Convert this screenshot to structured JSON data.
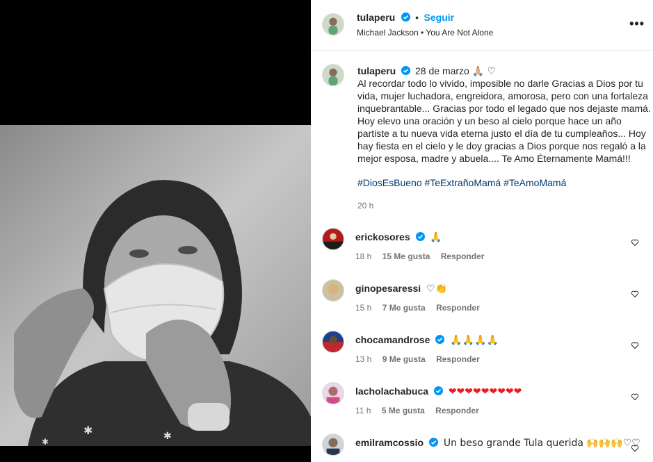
{
  "post": {
    "media_alt_icon": "person-with-face-mask-photo"
  },
  "header": {
    "username": "tulaperu",
    "separator": "•",
    "follow_label": "Seguir",
    "audio": "Michael Jackson • You Are Not Alone",
    "more_icon": "more-dots-icon"
  },
  "caption": {
    "username": "tulaperu",
    "date": "28 de marzo",
    "date_emojis": "🙏🏼 ♡",
    "lines": [
      "Al recordar todo lo vivido, imposible no darle Gracias a Dios por tu",
      "vida, mujer luchadora, engreidora, amorosa, pero con una fortaleza",
      "inquebrantable... Gracias por todo el legado que nos dejaste mamá.",
      "Hoy elevo una oración y un beso al cielo porque hace un año",
      "partiste a tu nueva vida eterna justo el día de tu cumpleaños... Hoy",
      "hay fiesta en el cielo y le doy gracias a Dios porque nos regaló a la",
      "mejor esposa, madre y abuela.... Te Amo Éternamente Mamá!!!"
    ],
    "hashtags": "#DiosEsBueno #TeExtrañoMamá #TeAmoMamá",
    "time": "20 h"
  },
  "comments": [
    {
      "username": "erickosores",
      "text": "🙏",
      "time": "18 h",
      "likes": "15 Me gusta",
      "reply": "Responder"
    },
    {
      "username": "ginopesaressi",
      "text": "♡👏",
      "time": "15 h",
      "likes": "7 Me gusta",
      "reply": "Responder"
    },
    {
      "username": "chocamandrose",
      "text": "🙏🙏🙏🙏",
      "time": "13 h",
      "likes": "9 Me gusta",
      "reply": "Responder"
    },
    {
      "username": "lacholachabuca",
      "text": "❤❤❤❤❤❤❤❤❤",
      "time": "11 h",
      "likes": "5 Me gusta",
      "reply": "Responder"
    },
    {
      "username": "emilramcossio",
      "text": "Un beso grande Tula querida 🙌🙌🙌♡♡",
      "time": "",
      "likes": "",
      "reply": ""
    }
  ],
  "colors": {
    "accent": "#0095f6",
    "verified": "#0095f6",
    "muted": "#737373",
    "hashtag": "#00376b"
  }
}
